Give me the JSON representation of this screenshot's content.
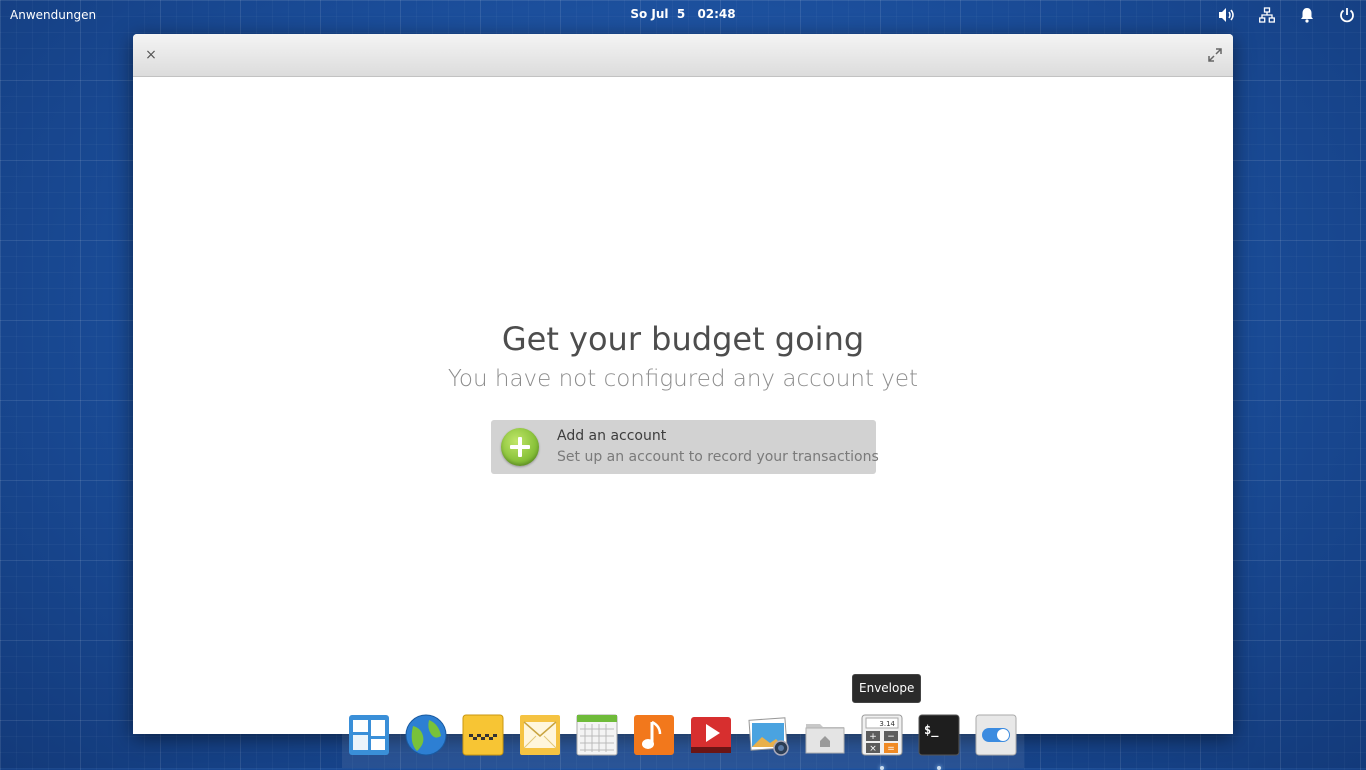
{
  "panel": {
    "applications": "Anwendungen",
    "date": "So Jul  5",
    "time": "02:48",
    "tray_icons": [
      "volume-icon",
      "network-icon",
      "notification-bell-icon",
      "power-icon"
    ]
  },
  "window": {
    "title_controls": [
      "close-icon",
      "maximize-icon"
    ],
    "close_glyph": "×"
  },
  "welcome": {
    "title": "Get your budget going",
    "subtitle": "You have not configured any account yet",
    "add_account": {
      "label": "Add an account",
      "description": "Set up an account to record your transactions"
    }
  },
  "tooltip": "Envelope",
  "dock": {
    "items": [
      {
        "name": "multitasking-view-icon"
      },
      {
        "name": "web-browser-icon"
      },
      {
        "name": "chat-icon"
      },
      {
        "name": "mail-icon"
      },
      {
        "name": "calendar-icon"
      },
      {
        "name": "music-icon"
      },
      {
        "name": "videos-icon"
      },
      {
        "name": "photos-icon"
      },
      {
        "name": "files-icon"
      },
      {
        "name": "calculator-icon",
        "running": true,
        "text": "3.14"
      },
      {
        "name": "terminal-icon",
        "running": true,
        "text": "$_"
      },
      {
        "name": "settings-icon"
      }
    ]
  }
}
